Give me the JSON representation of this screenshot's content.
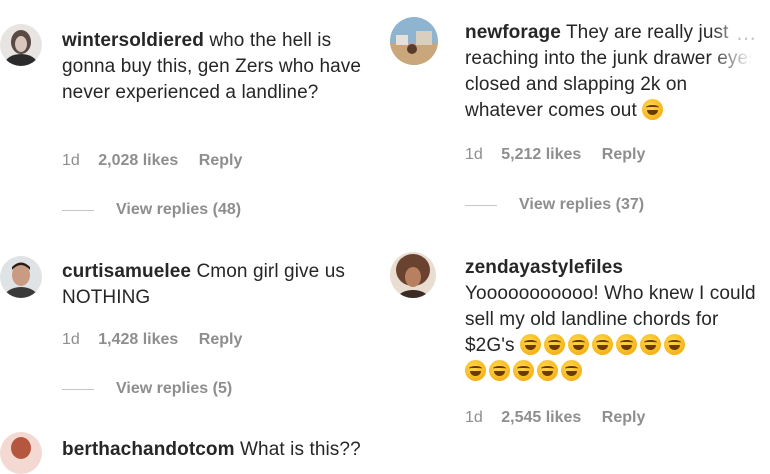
{
  "comments_left": [
    {
      "username": "wintersoldiered",
      "text": "who the hell is gonna buy this, gen Zers who have never experienced a landline?",
      "time": "1d",
      "likes": "2,028 likes",
      "reply": "Reply",
      "view_replies": "View replies (48)"
    },
    {
      "username": "curtisamuelee",
      "text": "Cmon girl give us NOTHING",
      "time": "1d",
      "likes": "1,428 likes",
      "reply": "Reply",
      "view_replies": "View replies (5)"
    },
    {
      "username": "berthachandotcom",
      "text": "What is this??"
    }
  ],
  "comments_right": [
    {
      "username": "newforage",
      "text": "They are really just reaching into the junk drawer eyes closed and slapping 2k on whatever comes out",
      "time": "1d",
      "likes": "5,212 likes",
      "reply": "Reply",
      "view_replies": "View replies (37)"
    },
    {
      "username": "zendayastylefiles",
      "text": "Yooooooooooo! Who knew I could sell my old landline chords for $2G's",
      "time": "1d",
      "likes": "2,545 likes",
      "reply": "Reply"
    }
  ],
  "emojis": {
    "newforage_count": 1,
    "zendaya_row1_count": 7,
    "zendaya_row2_count": 5,
    "icon": "rolling-on-floor-laughing"
  },
  "overlay": {
    "more_icon": "ellipsis-icon"
  }
}
